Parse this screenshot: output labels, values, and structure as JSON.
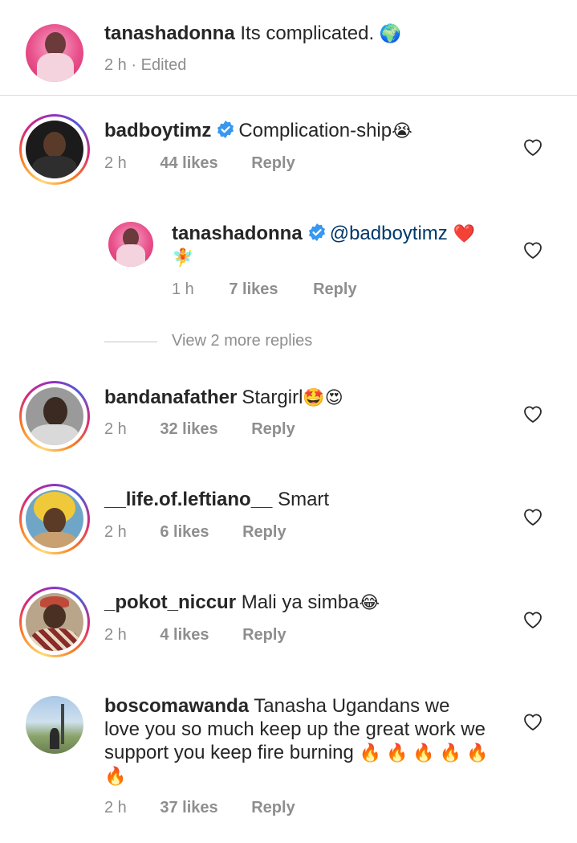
{
  "post_caption": {
    "username": "tanashadonna",
    "text": "Its complicated.",
    "emoji": "🌍",
    "time": "2 h",
    "separator": "·",
    "edited": "Edited"
  },
  "comments": [
    {
      "username": "badboytimz",
      "verified": true,
      "text": "Complication-ship",
      "emoji": "😭",
      "time": "2 h",
      "likes": "44 likes",
      "reply": "Reply"
    },
    {
      "username": "bandanafather",
      "verified": false,
      "text": "Stargirl",
      "emoji": "🤩😍",
      "time": "2 h",
      "likes": "32 likes",
      "reply": "Reply"
    },
    {
      "username": "__life.of.leftiano__",
      "verified": false,
      "text": "Smart",
      "emoji": "",
      "time": "2 h",
      "likes": "6 likes",
      "reply": "Reply"
    },
    {
      "username": "_pokot_niccur",
      "verified": false,
      "text": "Mali ya simba",
      "emoji": "😂",
      "time": "2 h",
      "likes": "4 likes",
      "reply": "Reply"
    },
    {
      "username": "boscomawanda",
      "verified": false,
      "text_line1": "Tanasha Ugandans we",
      "text_line2": "love you so much keep up the great work we",
      "text_line3": "support you keep fire burning",
      "emoji_line3": "🔥🔥🔥🔥🔥",
      "emoji_line4": "🔥",
      "time": "2 h",
      "likes": "37 likes",
      "reply": "Reply"
    }
  ],
  "reply": {
    "username": "tanashadonna",
    "verified": true,
    "mention": "@badboytimz",
    "emoji": "❤️",
    "emoji_line2": "🧚",
    "time": "1 h",
    "likes": "7 likes",
    "reply": "Reply"
  },
  "view_more": "View 2 more replies",
  "colors": {
    "verified_blue": "#3897f0",
    "meta_gray": "#8e8e8e",
    "link_blue": "#00376b"
  },
  "icons": [
    "heart-icon",
    "verified-badge-icon"
  ]
}
